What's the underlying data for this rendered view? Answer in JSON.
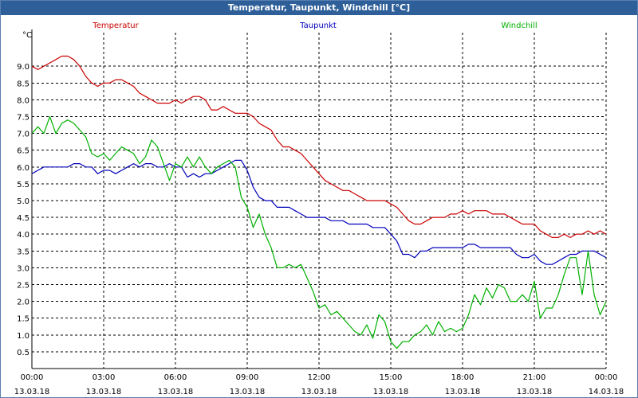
{
  "window": {
    "title": "Temperatur, Taupunkt, Windchill [°C]"
  },
  "colors": {
    "temperatur": "#cc0000",
    "taupunkt": "#0000bb",
    "windchill": "#00b000",
    "title_bar": "#2e5f99"
  },
  "chart_data": {
    "type": "line",
    "title": "Temperatur, Taupunkt, Windchill [°C]",
    "ylabel": "°C",
    "xlabel": "",
    "ylim": [
      0,
      10
    ],
    "yticks": [
      "0.5",
      "1.0",
      "1.5",
      "2.0",
      "2.5",
      "3.0",
      "3.5",
      "4.0",
      "4.5",
      "5.0",
      "5.5",
      "6.0",
      "6.5",
      "7.0",
      "7.5",
      "8.0",
      "8.5",
      "9.0"
    ],
    "x_unit": "hours since 13.03.18 00:00",
    "xlim": [
      0,
      24
    ],
    "xticks": [
      {
        "time": "00:00",
        "date": "13.03.18"
      },
      {
        "time": "03:00",
        "date": "13.03.18"
      },
      {
        "time": "06:00",
        "date": "13.03.18"
      },
      {
        "time": "09:00",
        "date": "13.03.18"
      },
      {
        "time": "12:00",
        "date": "13.03.18"
      },
      {
        "time": "15:00",
        "date": "13.03.18"
      },
      {
        "time": "18:00",
        "date": "13.03.18"
      },
      {
        "time": "21:00",
        "date": "13.03.18"
      },
      {
        "time": "00:00",
        "date": "14.03.18"
      }
    ],
    "grid": true,
    "legend": "top",
    "series": [
      {
        "name": "Temperatur",
        "x": [
          0,
          0.25,
          0.5,
          0.75,
          1,
          1.25,
          1.5,
          1.75,
          2,
          2.25,
          2.5,
          2.75,
          3,
          3.25,
          3.5,
          3.75,
          4,
          4.25,
          4.5,
          4.75,
          5,
          5.25,
          5.5,
          5.75,
          6,
          6.25,
          6.5,
          6.75,
          7,
          7.25,
          7.5,
          7.75,
          8,
          8.25,
          8.5,
          8.75,
          9,
          9.25,
          9.5,
          9.75,
          10,
          10.25,
          10.5,
          10.75,
          11,
          11.25,
          11.5,
          11.75,
          12,
          12.25,
          12.5,
          12.75,
          13,
          13.25,
          13.5,
          13.75,
          14,
          14.25,
          14.5,
          14.75,
          15,
          15.25,
          15.5,
          15.75,
          16,
          16.25,
          16.5,
          16.75,
          17,
          17.25,
          17.5,
          17.75,
          18,
          18.25,
          18.5,
          18.75,
          19,
          19.25,
          19.5,
          19.75,
          20,
          20.25,
          20.5,
          20.75,
          21,
          21.25,
          21.5,
          21.75,
          22,
          22.25,
          22.5,
          22.75,
          23,
          23.25,
          23.5,
          23.75,
          24
        ],
        "values": [
          9.0,
          8.9,
          9.0,
          9.1,
          9.2,
          9.3,
          9.3,
          9.2,
          9.0,
          8.7,
          8.5,
          8.4,
          8.5,
          8.5,
          8.6,
          8.6,
          8.5,
          8.4,
          8.2,
          8.1,
          8.0,
          7.9,
          7.9,
          7.9,
          8.0,
          7.9,
          8.0,
          8.1,
          8.1,
          8.0,
          7.7,
          7.7,
          7.8,
          7.7,
          7.6,
          7.6,
          7.6,
          7.5,
          7.3,
          7.2,
          7.1,
          6.8,
          6.6,
          6.6,
          6.5,
          6.4,
          6.2,
          6.0,
          5.8,
          5.6,
          5.5,
          5.4,
          5.3,
          5.3,
          5.2,
          5.1,
          5.0,
          5.0,
          5.0,
          5.0,
          4.9,
          4.8,
          4.6,
          4.4,
          4.3,
          4.3,
          4.4,
          4.5,
          4.5,
          4.5,
          4.6,
          4.6,
          4.7,
          4.6,
          4.7,
          4.7,
          4.7,
          4.6,
          4.6,
          4.6,
          4.5,
          4.4,
          4.3,
          4.3,
          4.3,
          4.1,
          4.0,
          3.9,
          3.9,
          4.0,
          3.9,
          4.0,
          4.0,
          4.1,
          4.0,
          4.1,
          4.0
        ]
      },
      {
        "name": "Taupunkt",
        "x": [
          0,
          0.25,
          0.5,
          0.75,
          1,
          1.25,
          1.5,
          1.75,
          2,
          2.25,
          2.5,
          2.75,
          3,
          3.25,
          3.5,
          3.75,
          4,
          4.25,
          4.5,
          4.75,
          5,
          5.25,
          5.5,
          5.75,
          6,
          6.25,
          6.5,
          6.75,
          7,
          7.25,
          7.5,
          7.75,
          8,
          8.25,
          8.5,
          8.75,
          9,
          9.25,
          9.5,
          9.75,
          10,
          10.25,
          10.5,
          10.75,
          11,
          11.25,
          11.5,
          11.75,
          12,
          12.25,
          12.5,
          12.75,
          13,
          13.25,
          13.5,
          13.75,
          14,
          14.25,
          14.5,
          14.75,
          15,
          15.25,
          15.5,
          15.75,
          16,
          16.25,
          16.5,
          16.75,
          17,
          17.25,
          17.5,
          17.75,
          18,
          18.25,
          18.5,
          18.75,
          19,
          19.25,
          19.5,
          19.75,
          20,
          20.25,
          20.5,
          20.75,
          21,
          21.25,
          21.5,
          21.75,
          22,
          22.25,
          22.5,
          22.75,
          23,
          23.25,
          23.5,
          23.75,
          24
        ],
        "values": [
          5.8,
          5.9,
          6.0,
          6.0,
          6.0,
          6.0,
          6.0,
          6.1,
          6.1,
          6.0,
          6.0,
          5.8,
          5.9,
          5.9,
          5.8,
          5.9,
          6.0,
          6.1,
          6.0,
          6.1,
          6.1,
          6.0,
          6.0,
          6.1,
          6.0,
          6.0,
          5.7,
          5.8,
          5.7,
          5.8,
          5.8,
          5.9,
          6.0,
          6.1,
          6.2,
          6.2,
          5.9,
          5.4,
          5.1,
          5.0,
          5.0,
          4.8,
          4.8,
          4.8,
          4.7,
          4.6,
          4.5,
          4.5,
          4.5,
          4.5,
          4.4,
          4.4,
          4.4,
          4.3,
          4.3,
          4.3,
          4.3,
          4.2,
          4.2,
          4.2,
          4.0,
          3.8,
          3.4,
          3.4,
          3.3,
          3.5,
          3.5,
          3.6,
          3.6,
          3.6,
          3.6,
          3.6,
          3.6,
          3.7,
          3.7,
          3.6,
          3.6,
          3.6,
          3.6,
          3.6,
          3.6,
          3.4,
          3.3,
          3.3,
          3.4,
          3.2,
          3.1,
          3.1,
          3.2,
          3.3,
          3.4,
          3.4,
          3.5,
          3.5,
          3.5,
          3.4,
          3.3
        ]
      },
      {
        "name": "Windchill",
        "x": [
          0,
          0.25,
          0.5,
          0.75,
          1,
          1.25,
          1.5,
          1.75,
          2,
          2.25,
          2.5,
          2.75,
          3,
          3.25,
          3.5,
          3.75,
          4,
          4.25,
          4.5,
          4.75,
          5,
          5.25,
          5.5,
          5.75,
          6,
          6.25,
          6.5,
          6.75,
          7,
          7.25,
          7.5,
          7.75,
          8,
          8.25,
          8.5,
          8.75,
          9,
          9.25,
          9.5,
          9.75,
          10,
          10.25,
          10.5,
          10.75,
          11,
          11.25,
          11.5,
          11.75,
          12,
          12.25,
          12.5,
          12.75,
          13,
          13.25,
          13.5,
          13.75,
          14,
          14.25,
          14.5,
          14.75,
          15,
          15.25,
          15.5,
          15.75,
          16,
          16.25,
          16.5,
          16.75,
          17,
          17.25,
          17.5,
          17.75,
          18,
          18.25,
          18.5,
          18.75,
          19,
          19.25,
          19.5,
          19.75,
          20,
          20.25,
          20.5,
          20.75,
          21,
          21.25,
          21.5,
          21.75,
          22,
          22.25,
          22.5,
          22.75,
          23,
          23.25,
          23.5,
          23.75,
          24
        ],
        "values": [
          7.0,
          7.2,
          7.0,
          7.5,
          7.0,
          7.3,
          7.4,
          7.3,
          7.1,
          6.9,
          6.4,
          6.3,
          6.4,
          6.2,
          6.4,
          6.6,
          6.5,
          6.4,
          6.1,
          6.3,
          6.8,
          6.6,
          6.1,
          5.6,
          6.1,
          6.0,
          6.3,
          6.0,
          6.3,
          6.0,
          5.8,
          6.0,
          6.1,
          6.2,
          6.0,
          5.1,
          4.8,
          4.2,
          4.6,
          4.0,
          3.6,
          3.0,
          3.0,
          3.1,
          3.0,
          3.1,
          2.7,
          2.3,
          1.8,
          1.9,
          1.6,
          1.7,
          1.5,
          1.3,
          1.1,
          1.0,
          1.3,
          0.9,
          1.6,
          1.4,
          0.8,
          0.6,
          0.8,
          0.8,
          1.0,
          1.1,
          1.3,
          1.0,
          1.4,
          1.1,
          1.2,
          1.1,
          1.2,
          1.6,
          2.2,
          1.9,
          2.4,
          2.1,
          2.5,
          2.4,
          2.0,
          2.0,
          2.2,
          2.0,
          2.6,
          1.5,
          1.8,
          1.8,
          2.2,
          2.8,
          3.3,
          3.3,
          2.2,
          3.5,
          2.2,
          1.6,
          2.0
        ]
      }
    ]
  }
}
